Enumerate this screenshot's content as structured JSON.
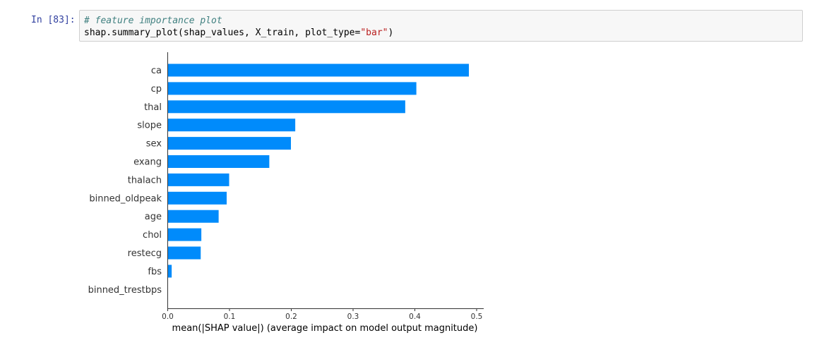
{
  "cell": {
    "prompt": "In [83]:",
    "comment": "# feature importance plot",
    "code_before_string": "shap.summary_plot(shap_values, X_train, plot_type=",
    "code_string": "\"bar\"",
    "code_after_string": ")"
  },
  "colors": {
    "bar": "#008bfb",
    "axis": "#333333",
    "text": "#333333",
    "prompt": "#303f9f"
  },
  "chart_data": {
    "type": "bar",
    "orientation": "horizontal",
    "categories": [
      "ca",
      "cp",
      "thal",
      "slope",
      "sex",
      "exang",
      "thalach",
      "binned_oldpeak",
      "age",
      "chol",
      "restecg",
      "fbs",
      "binned_trestbps"
    ],
    "values": [
      0.488,
      0.403,
      0.385,
      0.207,
      0.2,
      0.165,
      0.1,
      0.096,
      0.083,
      0.055,
      0.054,
      0.007,
      0.0
    ],
    "xlabel": "mean(|SHAP value|) (average impact on model output magnitude)",
    "ylabel": "",
    "title": "",
    "xlim": [
      0,
      0.52
    ],
    "xticks": [
      0.0,
      0.1,
      0.2,
      0.3,
      0.4,
      0.5
    ],
    "xtick_labels": [
      "0.0",
      "0.1",
      "0.2",
      "0.3",
      "0.4",
      "0.5"
    ],
    "grid": false,
    "legend": "none"
  }
}
